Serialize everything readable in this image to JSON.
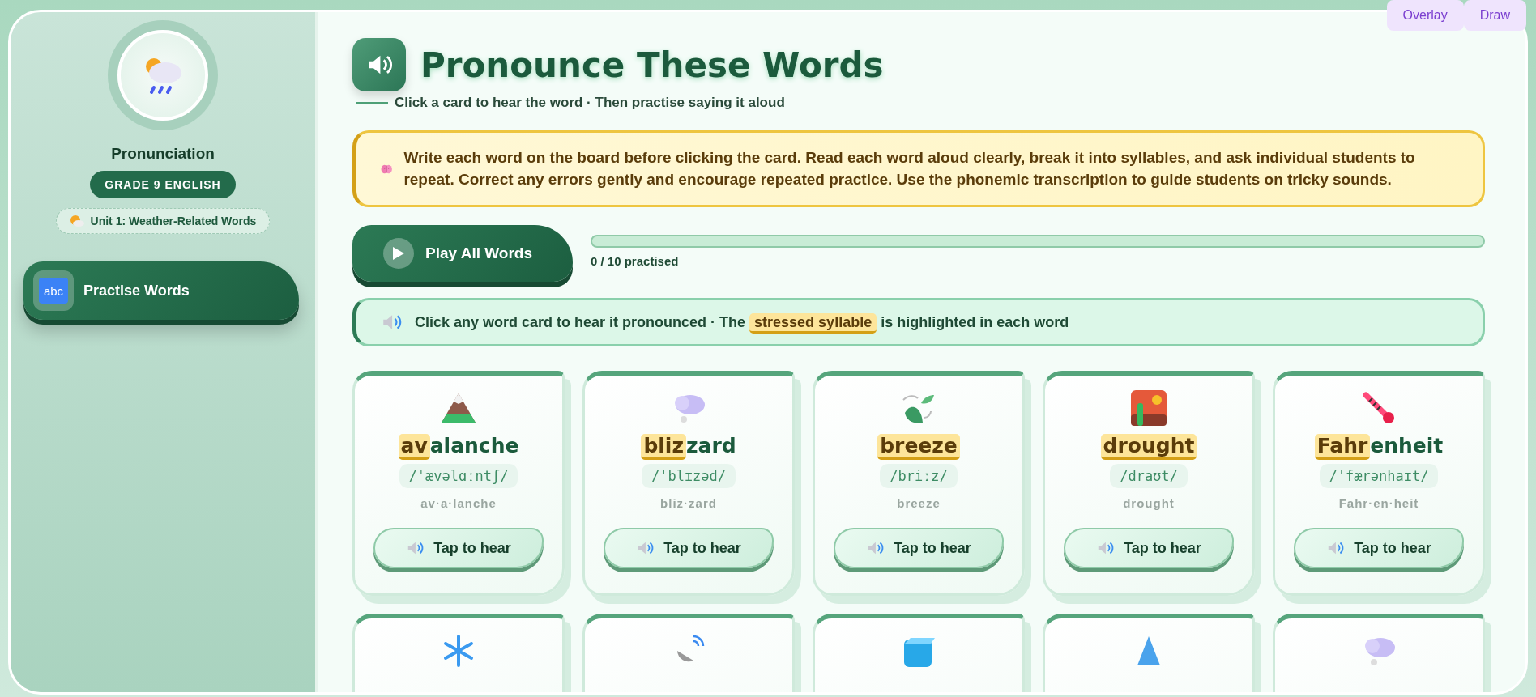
{
  "top_buttons": [
    {
      "label": "Overlay"
    },
    {
      "label": "Draw"
    }
  ],
  "sidebar": {
    "title": "Pronunciation",
    "grade": "GRADE 9 ENGLISH",
    "unit": "Unit 1: Weather-Related Words",
    "items": [
      {
        "icon_text": "abc",
        "label": "Practise Words",
        "selected": true
      }
    ]
  },
  "header": {
    "title": "Pronounce These Words",
    "subtitle": "Click a card to hear the word · Then practise saying it aloud"
  },
  "teacher_note": "Write each word on the board before clicking the card. Read each word aloud clearly, break it into syllables, and ask individual students to repeat. Correct any errors gently and encourage repeated practice. Use the phonemic transcription to guide students on tricky sounds.",
  "play_all": {
    "label": "Play All Words"
  },
  "progress": {
    "level": 0,
    "text": "0 / 10 practised"
  },
  "info": "Click any word card to hear it pronounced · The **stressed syllable** is highlighted in each word",
  "cards": [
    {
      "stressed": "av",
      "rest": "alanche",
      "ipa": "/ˈævəlɑːntʃ/",
      "syllables": "av·a·lanche",
      "button": "Tap to hear"
    },
    {
      "stressed": "bliz",
      "rest": "zard",
      "ipa": "/ˈblɪzəd/",
      "syllables": "bliz·zard",
      "button": "Tap to hear"
    },
    {
      "stressed": "breeze",
      "ipa": "/briːz/",
      "syllables": "breeze",
      "button": "Tap to hear"
    },
    {
      "stressed": "drought",
      "ipa": "/draʊt/",
      "syllables": "drought",
      "button": "Tap to hear"
    },
    {
      "stressed": "Fahr",
      "rest": "enheit",
      "ipa": "/ˈfærənhaɪt/",
      "syllables": "Fahr·en·heit",
      "button": "Tap to hear"
    }
  ]
}
